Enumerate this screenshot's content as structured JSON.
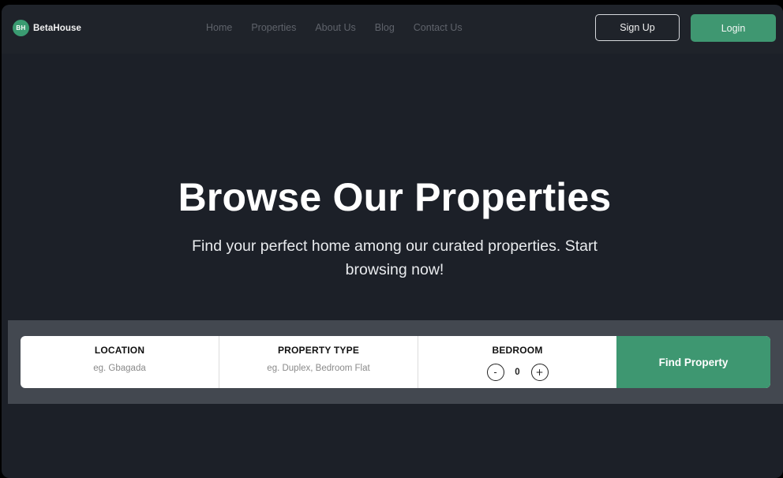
{
  "brand": {
    "badge": "BH",
    "name": "BetaHouse",
    "accent_color": "#3e9771"
  },
  "nav": {
    "links": [
      "Home",
      "Properties",
      "About Us",
      "Blog",
      "Contact Us"
    ],
    "signup_label": "Sign Up",
    "login_label": "Login"
  },
  "hero": {
    "title": "Browse Our Properties",
    "subtitle": "Find your perfect home among our curated properties. Start browsing now!"
  },
  "search": {
    "location": {
      "label": "LOCATION",
      "placeholder": "eg. Gbagada",
      "value": ""
    },
    "property_type": {
      "label": "PROPERTY TYPE",
      "placeholder": "eg. Duplex, Bedroom Flat",
      "value": ""
    },
    "bedroom": {
      "label": "BEDROOM",
      "decrement": "-",
      "value": "0",
      "increment": "+"
    },
    "submit_label": "Find Property"
  }
}
